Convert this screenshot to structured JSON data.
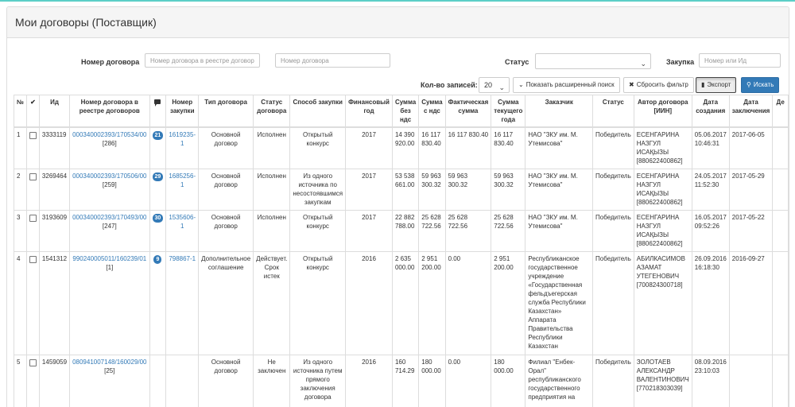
{
  "header": {
    "title": "Мои договоры (Поставщик)"
  },
  "filters": {
    "contract_label": "Номер договора",
    "contract_registry_placeholder": "Номер договора в реестре договор",
    "contract_placeholder": "Номер договора",
    "status_label": "Статус",
    "status_value": "",
    "purchase_label": "Закупка",
    "purchase_placeholder": "Номер или Ид",
    "records_label": "Кол-во записей:",
    "records_value": "20",
    "advanced_search": "Показать расширенный поиск",
    "reset_filter": "Сбросить фильтр",
    "export": "Экспорт",
    "search": "Искать"
  },
  "table": {
    "columns": [
      "№",
      "✔",
      "Ид",
      "Номер договора в реестре договоров",
      "",
      "Номер закупки",
      "Тип договора",
      "Статус договора",
      "Способ закупки",
      "Финансовый год",
      "Сумма без ндс",
      "Сумма с ндс",
      "Фактическая сумма",
      "Сумма текущего года",
      "Заказчик",
      "Статус",
      "Автор договора [ИИН]",
      "Дата создания",
      "Дата заключения",
      "Де"
    ],
    "rows": [
      {
        "n": "1",
        "id": "3333119",
        "contract": "000340002393/170534/00",
        "contract_sub": "[286]",
        "badge": "21",
        "purchase": "1619235-1",
        "type": "Основной договор",
        "status": "Исполнен",
        "method": "Открытый конкурс",
        "year": "2017",
        "sum_no_vat": "14 390 920.00",
        "sum_vat": "16 117 830.40",
        "actual": "16 117 830.40",
        "current": "16 117 830.40",
        "customer": "НАО \"ЗКУ им. М. Утемисова\"",
        "state": "Победитель",
        "author": "ЕСЕНГАРИНА НАЗГУЛ ИСАҚЫЗЫ [880622400862]",
        "created": "05.06.2017 10:46:31",
        "concluded": "2017-06-05"
      },
      {
        "n": "2",
        "id": "3269464",
        "contract": "000340002393/170506/00",
        "contract_sub": "[259]",
        "badge": "29",
        "purchase": "1685256-1",
        "type": "Основной договор",
        "status": "Исполнен",
        "method": "Из одного источника по несостоявшимся закупкам",
        "year": "2017",
        "sum_no_vat": "53 538 661.00",
        "sum_vat": "59 963 300.32",
        "actual": "59 963 300.32",
        "current": "59 963 300.32",
        "customer": "НАО \"ЗКУ им. М. Утемисова\"",
        "state": "Победитель",
        "author": "ЕСЕНГАРИНА НАЗГУЛ ИСАҚЫЗЫ [880622400862]",
        "created": "24.05.2017 11:52:30",
        "concluded": "2017-05-29"
      },
      {
        "n": "3",
        "id": "3193609",
        "contract": "000340002393/170493/00",
        "contract_sub": "[247]",
        "badge": "30",
        "purchase": "1535606-1",
        "type": "Основной договор",
        "status": "Исполнен",
        "method": "Открытый конкурс",
        "year": "2017",
        "sum_no_vat": "22 882 788.00",
        "sum_vat": "25 628 722.56",
        "actual": "25 628 722.56",
        "current": "25 628 722.56",
        "customer": "НАО \"ЗКУ им. М. Утемисова\"",
        "state": "Победитель",
        "author": "ЕСЕНГАРИНА НАЗГУЛ ИСАҚЫЗЫ [880622400862]",
        "created": "16.05.2017 09:52:26",
        "concluded": "2017-05-22"
      },
      {
        "n": "4",
        "id": "1541312",
        "contract": "990240005011/160239/01",
        "contract_sub": "[1]",
        "badge": "9",
        "purchase": "798867-1",
        "type": "Дополнительное соглашение",
        "status": "Действует. Срок истек",
        "method": "Открытый конкурс",
        "year": "2016",
        "sum_no_vat": "2 635 000.00",
        "sum_vat": "2 951 200.00",
        "actual": "0.00",
        "current": "2 951 200.00",
        "customer": "Республиканское государственное учреждение «Государственная фельдъегерская служба Республики Казахстан» Аппарата Правительства Республики Казахстан",
        "state": "Победитель",
        "author": "АБИЛКАСИМОВ АЗАМАТ УТЕГЕНОВИЧ [700824300718]",
        "created": "26.09.2016 16:18:30",
        "concluded": "2016-09-27"
      },
      {
        "n": "5",
        "id": "1459059",
        "contract": "080941007148/160029/00",
        "contract_sub": "[25]",
        "badge": "",
        "purchase": "",
        "type": "Основной договор",
        "status": "Не заключен",
        "method": "Из одного источника путем прямого заключения договора",
        "year": "2016",
        "sum_no_vat": "160 714.29",
        "sum_vat": "180 000.00",
        "actual": "0.00",
        "current": "180 000.00",
        "customer": "Филиал \"Енбек-Орал\" республиканского государственного предприятия на",
        "state": "Победитель",
        "author": "ЗОЛОТАЕВ АЛЕКСАНДР ВАЛЕНТИНОВИЧ [770218303039]",
        "created": "08.09.2016 23:10:03",
        "concluded": ""
      }
    ]
  },
  "colors": {
    "accent": "#337ab7",
    "topline": "#5ccfc7"
  },
  "icons": {
    "comments": "comment-icon",
    "export": "file-icon",
    "search": "search-icon",
    "reset": "times-icon",
    "advanced": "chevron-down-icon"
  }
}
